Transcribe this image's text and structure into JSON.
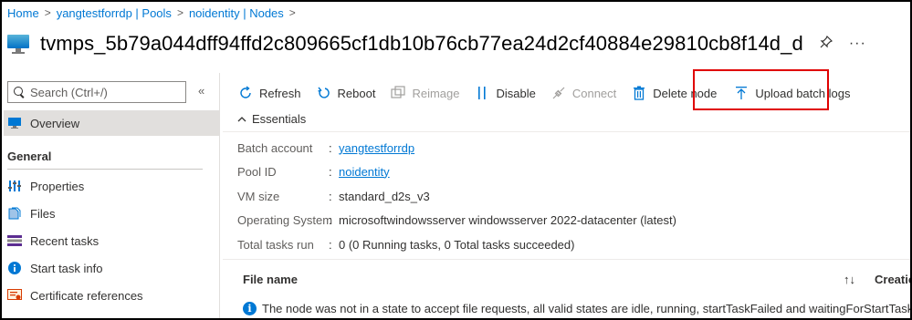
{
  "breadcrumb": [
    {
      "label": "Home"
    },
    {
      "label": "yangtestforrdp | Pools"
    },
    {
      "label": "noidentity | Nodes"
    }
  ],
  "breadcrumb_sep": ">",
  "title": "tvmps_5b79a044dff94ffd2c809665cf1db10b76cb77ea24d2cf40884e29810cb8f14d_d",
  "title_actions": {
    "pin_icon": "pin-icon",
    "more_label": "···"
  },
  "sidebar": {
    "search_placeholder": "Search (Ctrl+/)",
    "collapse_label": "«",
    "overview_label": "Overview",
    "section_title": "General",
    "items": [
      {
        "label": "Properties",
        "icon": "properties-icon"
      },
      {
        "label": "Files",
        "icon": "files-icon"
      },
      {
        "label": "Recent tasks",
        "icon": "recent-tasks-icon"
      },
      {
        "label": "Start task info",
        "icon": "info-icon"
      },
      {
        "label": "Certificate references",
        "icon": "certificate-icon"
      }
    ]
  },
  "toolbar": {
    "refresh": "Refresh",
    "reboot": "Reboot",
    "reimage": "Reimage",
    "disable": "Disable",
    "connect": "Connect",
    "delete_node": "Delete node",
    "upload_batch_logs": "Upload batch logs"
  },
  "essentials": {
    "title": "Essentials",
    "rows": [
      {
        "key": "Batch account",
        "value": "yangtestforrdp",
        "link": true
      },
      {
        "key": "Pool ID",
        "value": "noidentity",
        "link": true
      },
      {
        "key": "VM size",
        "value": "standard_d2s_v3",
        "link": false
      },
      {
        "key": "Operating System",
        "value": "microsoftwindowsserver windowsserver 2022-datacenter (latest)",
        "link": false
      },
      {
        "key": "Total tasks run",
        "value": "0 (0 Running tasks, 0 Total tasks succeeded)",
        "link": false
      }
    ],
    "colon": ":"
  },
  "files": {
    "col_name": "File name",
    "sort_icon": "↑↓",
    "col_created": "Creation",
    "info_icon": "i",
    "message": "The node was not in a state to accept file requests, all valid states are idle, running, startTaskFailed and waitingForStartTask."
  },
  "colors": {
    "accent": "#0078d4",
    "highlight_border": "#e00000"
  }
}
